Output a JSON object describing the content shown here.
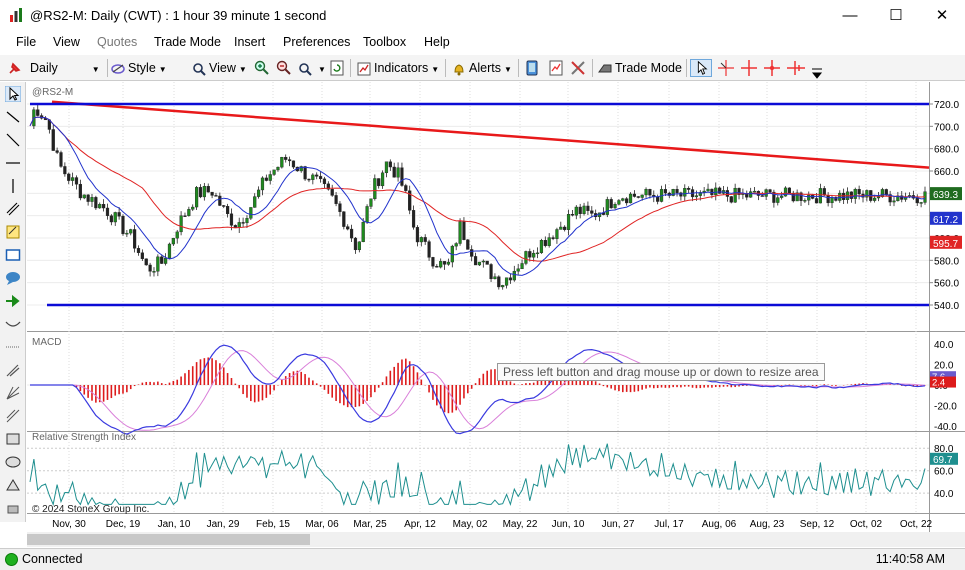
{
  "window": {
    "title": "@RS2-M: Daily (CWT) : 1 hour 39 minute 1 second",
    "minimize": "—",
    "maximize": "☐",
    "close": "✕"
  },
  "menu": {
    "items": [
      "File",
      "View",
      "Quotes",
      "Trade Mode",
      "Insert",
      "Preferences",
      "Toolbox",
      "Help"
    ],
    "disabled": [
      "Quotes"
    ]
  },
  "toolbar": {
    "interval": "Daily",
    "style": "Style",
    "view": "View",
    "indicators": "Indicators",
    "alerts": "Alerts",
    "trade_mode": "Trade Mode"
  },
  "chart": {
    "symbol_label": "@RS2-M",
    "copyright": "© 2024 StoneX Group Inc.",
    "price_axis_ticks": [
      "720.0",
      "700.0",
      "680.0",
      "660.0",
      "640.0",
      "620.0",
      "600.0",
      "580.0",
      "560.0",
      "540.0"
    ],
    "last_price_tag": "639.3",
    "ma_fast_tag": "617.2",
    "ma_slow_tag": "595.7",
    "x_labels": [
      "Nov, 30",
      "Dec, 19",
      "Jan, 10",
      "Jan, 29",
      "Feb, 15",
      "Mar, 06",
      "Mar, 25",
      "Apr, 12",
      "May, 02",
      "May, 22",
      "Jun, 10",
      "Jun, 27",
      "Jul, 17",
      "Aug, 06",
      "Aug, 23",
      "Sep, 12",
      "Oct, 02",
      "Oct, 22"
    ]
  },
  "macd": {
    "label": "MACD",
    "axis_ticks": [
      "40.0",
      "20.0",
      "0.0",
      "-20.0",
      "-40.0"
    ],
    "tag_macd": "7.6",
    "tag_hist": "2.4"
  },
  "rsi": {
    "label": "Relative Strength Index",
    "axis_ticks": [
      "80.0",
      "60.0",
      "40.0"
    ],
    "tag_value": "69.7"
  },
  "tooltip": "Press left button and drag mouse up or down to resize area",
  "status": {
    "connection": "Connected",
    "time": "11:40:58 AM"
  },
  "colors": {
    "trendline": "#e8191a",
    "support_resistance": "#0b0bd6",
    "ma_fast": "#2233cc",
    "ma_slow": "#e02424",
    "candle_up": "#1f8a1f",
    "candle_down": "#222222",
    "macd_line": "#3a3adf",
    "signal_line": "#d97fd9",
    "hist": "#dd1b1b",
    "rsi_line": "#1e8f8f"
  },
  "icons": [
    "app-icon",
    "pin-icon",
    "style-icon",
    "magnifier-icon",
    "zoom-in-icon",
    "zoom-out-icon",
    "zoom-fit-icon",
    "refresh-icon",
    "indicators-icon",
    "bell-icon",
    "tablet-icon",
    "tools-icon",
    "trade-mode-icon",
    "cursor-icon",
    "crosshair-icon"
  ]
}
